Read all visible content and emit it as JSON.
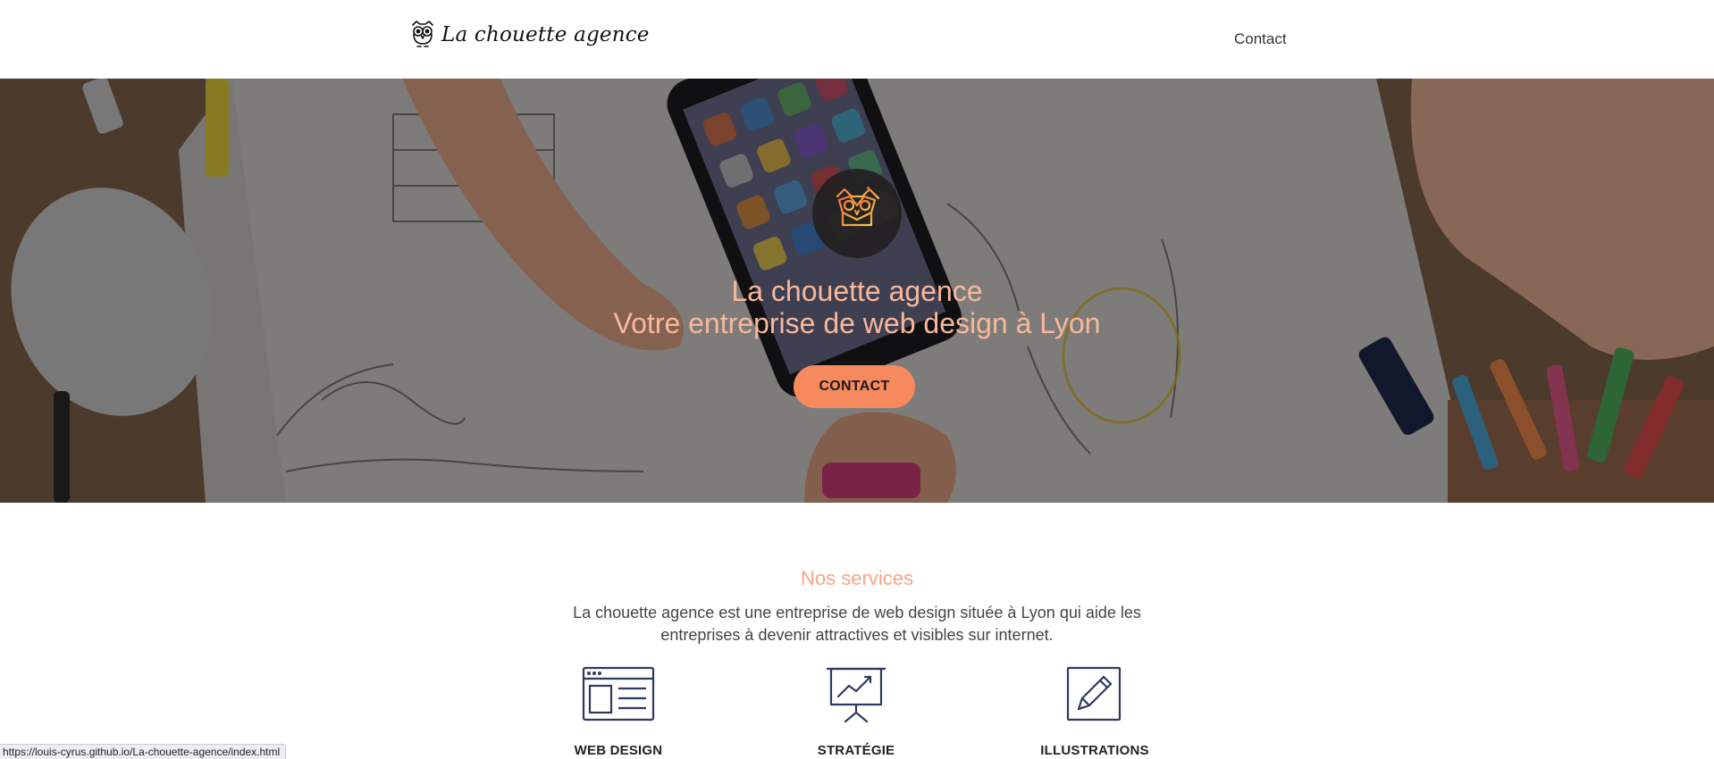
{
  "header": {
    "brand_name": "La chouette agence",
    "nav": {
      "contact_label": "Contact"
    }
  },
  "hero": {
    "title": "La chouette agence",
    "subtitle": "Votre entreprise de web design à Lyon",
    "cta_label": "CONTACT",
    "badge_icon": "owl-logo-icon"
  },
  "services": {
    "title": "Nos services",
    "description": "La chouette agence est une entreprise de web design située à Lyon qui aide les entreprises à devenir attractives et visibles sur internet.",
    "items": [
      {
        "label": "WEB DESIGN",
        "icon": "browser-window-icon"
      },
      {
        "label": "STRATÉGIE",
        "icon": "presentation-chart-icon"
      },
      {
        "label": "ILLUSTRATIONS",
        "icon": "pencil-icon"
      }
    ]
  },
  "status_bar": {
    "url": "https://louis-cyrus.github.io/La-chouette-agence/index.html"
  },
  "colors": {
    "accent": "#f7895e",
    "hero_text": "#f8b89a",
    "services_title": "#f8a487",
    "icon_stroke": "#2f3a5f"
  }
}
